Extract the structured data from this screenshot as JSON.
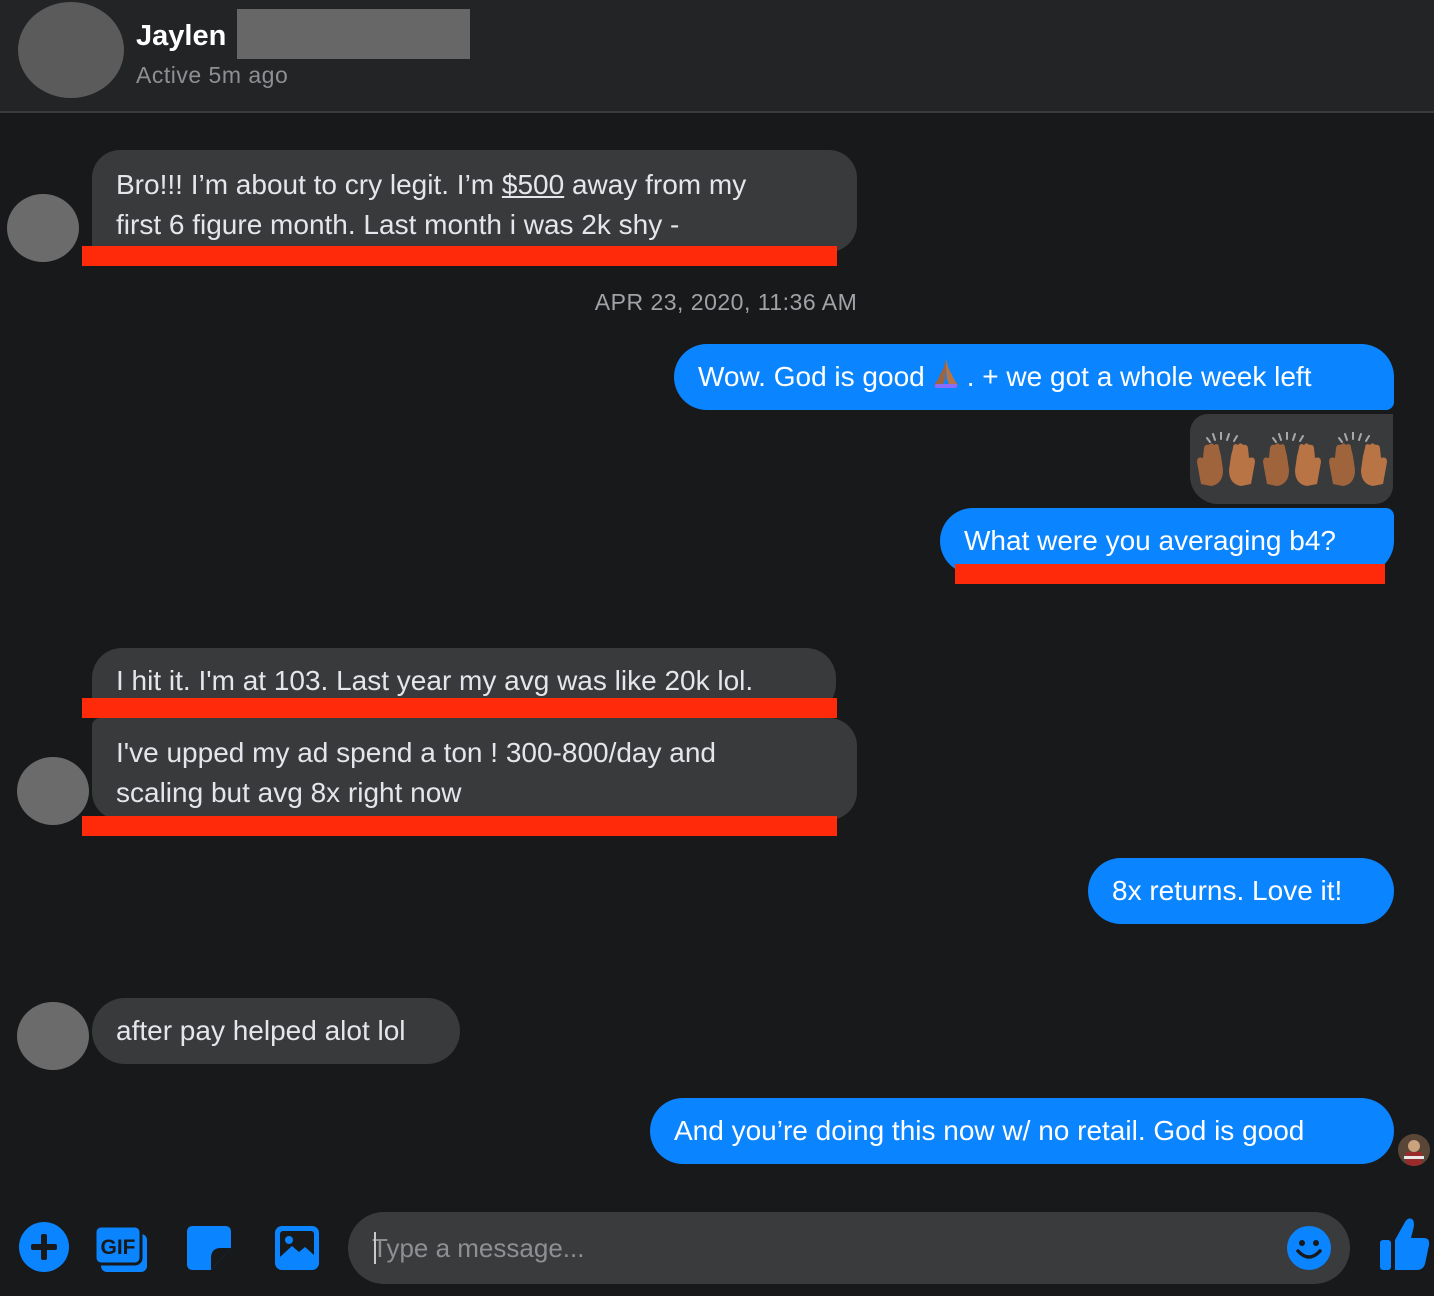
{
  "header": {
    "contact_name": "Jaylen",
    "status": "Active 5m ago"
  },
  "messages": {
    "m1": {
      "direction": "incoming",
      "text_before": "Bro!!! I’m about to cry legit. I’m ",
      "amount": "$500",
      "text_after": " away from my",
      "line2": "first 6 figure month. Last month i was 2k shy -"
    },
    "timestamp": "APR 23, 2020, 11:36 AM",
    "m2": {
      "direction": "outgoing",
      "text_before": "Wow. God is good",
      "emoji": "folded-hands",
      "text_after": ". + we got a whole week left"
    },
    "m3": {
      "direction": "outgoing",
      "emoji": [
        "raising-hands",
        "raising-hands",
        "raising-hands"
      ]
    },
    "m4": {
      "direction": "outgoing",
      "text": "What were you averaging b4?"
    },
    "m5": {
      "direction": "incoming",
      "text": "I hit it. I'm at 103. Last year my avg was like 20k lol."
    },
    "m6": {
      "direction": "incoming",
      "line1": "I've upped my ad spend a ton ! 300-800/day and",
      "line2": "scaling but avg 8x right now"
    },
    "m7": {
      "direction": "outgoing",
      "text": "8x returns. Love it!"
    },
    "m8": {
      "direction": "incoming",
      "text": "after pay helped alot lol"
    },
    "m9": {
      "direction": "outgoing",
      "text": "And you’re doing this now w/ no retail. God is good"
    }
  },
  "composer": {
    "placeholder": "Type a message...",
    "value": "",
    "icons": [
      "plus-icon",
      "gif-icon",
      "sticker-icon",
      "image-icon",
      "emoji-icon",
      "thumbs-up-icon"
    ],
    "gif_label": "GIF"
  },
  "colors": {
    "background": "#18191b",
    "incoming_bubble": "#393a3c",
    "outgoing_bubble": "#0a84ff",
    "highlight_underline": "#ff2a0a",
    "accent": "#0a84ff"
  }
}
